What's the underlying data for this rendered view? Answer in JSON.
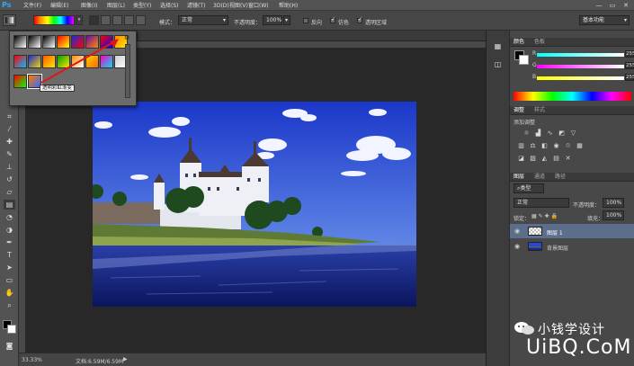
{
  "app": {
    "logo": "Ps"
  },
  "menu": {
    "items": [
      "文件(F)",
      "编辑(E)",
      "图像(I)",
      "图层(L)",
      "类型(Y)",
      "选择(S)",
      "滤镜(T)",
      "3D(D)",
      "视图(V)",
      "窗口(W)",
      "帮助(H)"
    ]
  },
  "window_controls": {
    "minimize": "—",
    "restore": "▭",
    "close": "✕"
  },
  "options": {
    "mode_label": "模式：",
    "mode_value": "正常",
    "opacity_label": "不透明度：",
    "opacity_value": "100%",
    "reverse_label": "反向",
    "dither_label": "仿色",
    "transparency_label": "透明区域",
    "reverse_checked": false,
    "dither_checked": true,
    "transparency_checked": true,
    "workspace_value": "基本功能"
  },
  "gradient_picker": {
    "tooltip": "透明彩虹渐变",
    "swatch_colors": [
      [
        "#000000",
        "#ffffff"
      ],
      [
        "#000000",
        "#ffffff"
      ],
      [
        "#000000",
        "#ffffff"
      ],
      [
        "#ff0000",
        "#ffff00"
      ],
      [
        "#1d2bd6",
        "#ff0000"
      ],
      [
        "#6a0aa5",
        "#ff8a00"
      ],
      [
        "#ff0000",
        "#0000ff"
      ],
      [
        "#ff8a00",
        "#ffe600"
      ],
      [
        "#ff0000",
        "#00c0ff"
      ],
      [
        "#1d2bd6",
        "#f3d300"
      ],
      [
        "#ff5a00",
        "#ffe600"
      ],
      [
        "#00a000",
        "#ffe600"
      ],
      [
        "#ff8a00",
        "#ffffff"
      ],
      [
        "#ffd000",
        "#ff6a00"
      ],
      [
        "#ff00b4",
        "#00e0ff"
      ],
      [
        "#cfcfcf",
        "#ffffff"
      ],
      [
        "#ff0000",
        "#00ff00"
      ],
      [
        "#ff7a00",
        "#2e6bff"
      ]
    ]
  },
  "color_panel": {
    "tabs": [
      "颜色",
      "色板"
    ],
    "sliders": [
      {
        "label": "R",
        "value": "255",
        "from": "#00ffff",
        "to": "#ffffff"
      },
      {
        "label": "G",
        "value": "255",
        "from": "#ff00ff",
        "to": "#ffffff"
      },
      {
        "label": "B",
        "value": "255",
        "from": "#ffff00",
        "to": "#ffffff"
      }
    ]
  },
  "adjust_panel": {
    "tabs": [
      "调整",
      "样式"
    ],
    "title": "添加调整"
  },
  "layers_panel": {
    "tabs": [
      "图层",
      "通道",
      "路径"
    ],
    "filter_value": "类型",
    "blend_value": "正常",
    "opacity_label": "不透明度：",
    "opacity_value": "100%",
    "lock_label": "锁定：",
    "fill_label": "填充：",
    "fill_value": "100%",
    "layers": [
      {
        "name": "图层 1",
        "selected": true
      },
      {
        "name": "背景图层",
        "selected": false
      }
    ]
  },
  "status": {
    "zoom": "33.33%",
    "doc_info": "文档:6.59M/6.59M"
  },
  "watermark": {
    "text": "小钱学设计",
    "logo_text": "UiBQ.CoM"
  },
  "colors": {
    "accent": "#2fa8ff",
    "menubar": "#535353",
    "panel": "#484848"
  }
}
